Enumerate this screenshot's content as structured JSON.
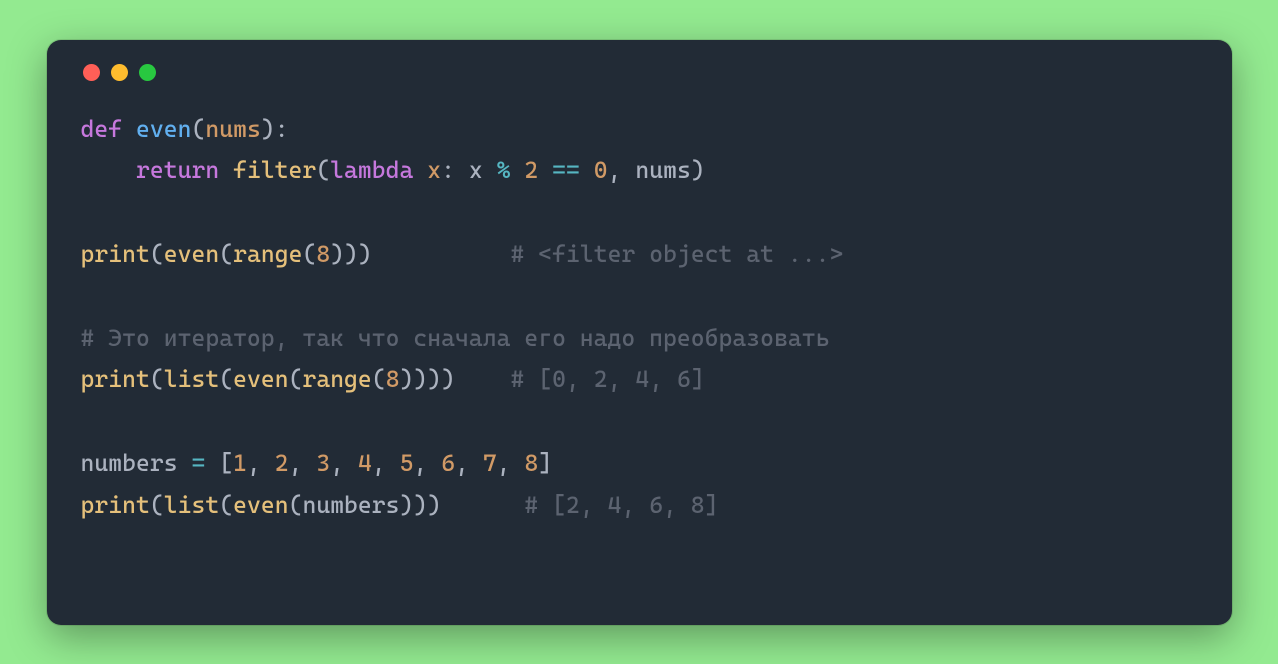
{
  "colors": {
    "background_page": "#93ea90",
    "background_window": "#222b36",
    "traffic_red": "#ff5f57",
    "traffic_yellow": "#febc2e",
    "traffic_green": "#28c840",
    "keyword": "#c678dd",
    "function_def": "#61afef",
    "call_builtin": "#e5c07b",
    "param_num": "#d19a66",
    "operator": "#56b6c2",
    "var_ident": "#e06c75",
    "comment": "#5c6370",
    "default_text": "#abb2bf"
  },
  "code": {
    "l1": {
      "def": "def ",
      "name": "even",
      "lp": "(",
      "param": "nums",
      "rp": "):"
    },
    "l2": {
      "ind": "    ",
      "ret": "return ",
      "call": "filter",
      "lp": "(",
      "lam": "lambda ",
      "x1": "x",
      "colon": ": ",
      "x2": "x ",
      "op1": "% ",
      "two": "2 ",
      "op2": "== ",
      "zero": "0",
      "comma": ", ",
      "arg": "nums",
      "rp": ")"
    },
    "l4": {
      "call": "print",
      "lp": "(",
      "even_call": "even",
      "lp2": "(",
      "range_call": "range",
      "lp3": "(",
      "num": "8",
      "close": ")))",
      "pad": "          ",
      "cmt": "# <filter object at ...>"
    },
    "l6": {
      "cmt": "# Это итератор, так что сначала его надо преобразовать"
    },
    "l7": {
      "call": "print",
      "lp": "(",
      "list_call": "list",
      "lp2": "(",
      "even_call": "even",
      "lp3": "(",
      "range_call": "range",
      "lp4": "(",
      "num": "8",
      "close": "))))",
      "pad": "    ",
      "cmt": "# [0, 2, 4, 6]"
    },
    "l9": {
      "name": "numbers ",
      "eq": "= ",
      "lb": "[",
      "n1": "1",
      "c1": ", ",
      "n2": "2",
      "c2": ", ",
      "n3": "3",
      "c3": ", ",
      "n4": "4",
      "c4": ", ",
      "n5": "5",
      "c5": ", ",
      "n6": "6",
      "c6": ", ",
      "n7": "7",
      "c7": ", ",
      "n8": "8",
      "rb": "]"
    },
    "l10": {
      "call": "print",
      "lp": "(",
      "list_call": "list",
      "lp2": "(",
      "even_call": "even",
      "lp3": "(",
      "arg": "numbers",
      "close": ")))",
      "pad": "      ",
      "cmt": "# [2, 4, 6, 8]"
    }
  }
}
